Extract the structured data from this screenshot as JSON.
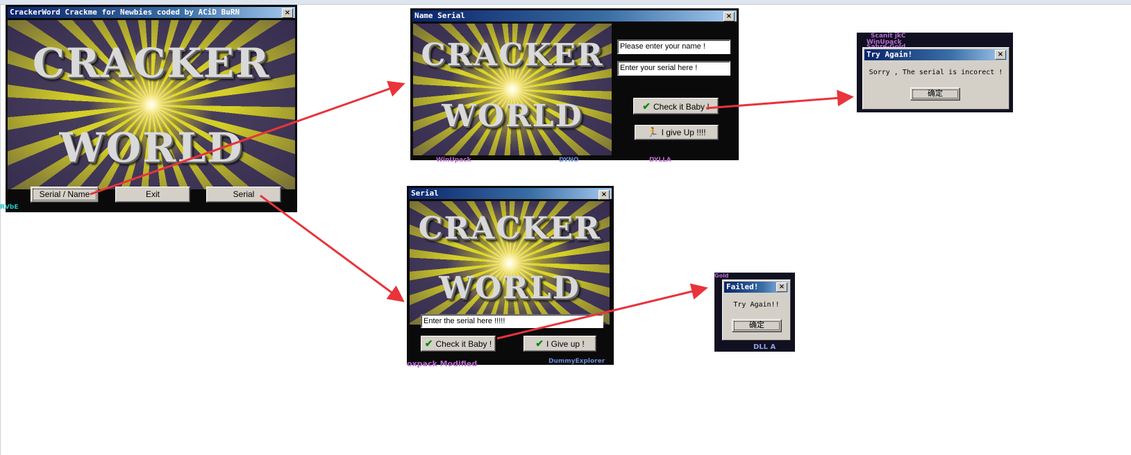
{
  "main": {
    "title": "CrackerWord Crackme for Newbies coded by ACiD BuRN",
    "close": "×",
    "art_line1": "CRACKER",
    "art_line2": "WORLD",
    "buttons": {
      "serial_name": "Serial / Name",
      "exit": "Exit",
      "serial": "Serial"
    }
  },
  "name_serial": {
    "title": "Name Serial",
    "close": "×",
    "art_line1": "CRACKER",
    "art_line2": "WORLD",
    "name_value": "Please enter your name !",
    "serial_value": "Enter your serial here !",
    "check_label": "Check it Baby !",
    "giveup_label": "I give Up !!!!"
  },
  "serial": {
    "title": "Serial",
    "close": "×",
    "art_line1": "CRACKER",
    "art_line2": "WORLD",
    "serial_value": "Enter the serial here !!!!!",
    "check_label": "Check it Baby !",
    "giveup_label": "I Give up !"
  },
  "try_again": {
    "title": "Try Again!",
    "close": "×",
    "message": "Sorry , The serial is incorect !",
    "ok": "确定",
    "bg_text": [
      "Scanit jkC",
      "WinUpack",
      "Sahre-Gold"
    ]
  },
  "failed": {
    "title": "Failed!",
    "close": "×",
    "message": "Try Again!!",
    "ok": "确定",
    "bg_text": [
      "Gold",
      "DLL A"
    ]
  },
  "background_text": {
    "under_main": "RVbE",
    "under_name_serial": [
      "WinUpack",
      "DYNO",
      "DYLLA"
    ],
    "under_serial": [
      "oxpack Modified",
      "DummyExplorer"
    ]
  },
  "colors": {
    "arrow": "#e8343a",
    "title_start": "#0a246a",
    "title_end": "#a6caf0",
    "button_face": "#d4d0c8"
  }
}
